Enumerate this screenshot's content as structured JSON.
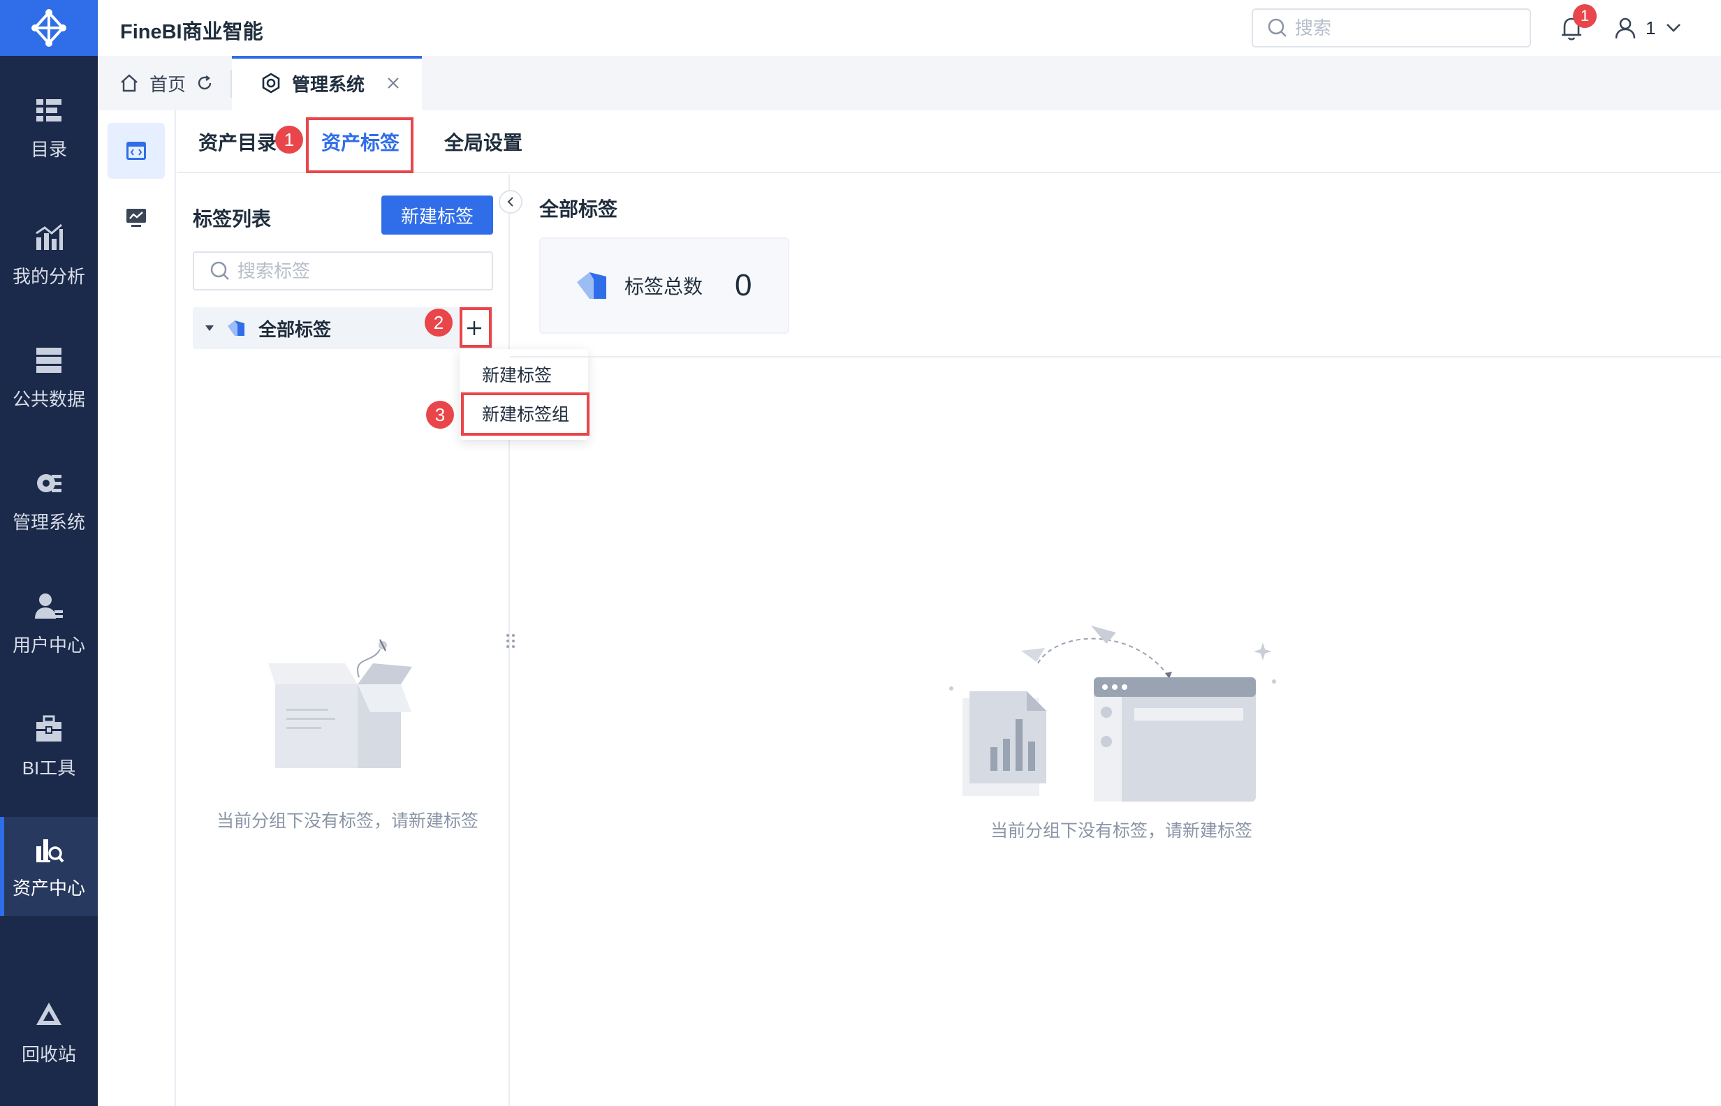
{
  "app": {
    "title": "FineBI商业智能"
  },
  "header": {
    "search_placeholder": "搜索",
    "notification_count": "1",
    "user_name": "1"
  },
  "nav": {
    "items": [
      {
        "label": "目录",
        "icon": "catalog-icon"
      },
      {
        "label": "我的分析",
        "icon": "analysis-icon"
      },
      {
        "label": "公共数据",
        "icon": "public-data-icon"
      },
      {
        "label": "管理系统",
        "icon": "gear-icon"
      },
      {
        "label": "用户中心",
        "icon": "user-center-icon"
      },
      {
        "label": "BI工具",
        "icon": "toolbox-icon"
      },
      {
        "label": "资产中心",
        "icon": "asset-center-icon",
        "active": true
      }
    ],
    "recycle_label": "回收站"
  },
  "tabs": {
    "home": "首页",
    "admin": "管理系统"
  },
  "content_tabs": [
    "资产目录",
    "资产标签",
    "全局设置"
  ],
  "steps": [
    "1",
    "2",
    "3"
  ],
  "left_panel": {
    "title": "标签列表",
    "new_button": "新建标签",
    "search_placeholder": "搜索标签",
    "tree_root": "全部标签",
    "empty_text": "当前分组下没有标签，请新建标签"
  },
  "menu": {
    "items": [
      "新建标签",
      "新建标签组"
    ]
  },
  "right_panel": {
    "title": "全部标签",
    "stat_label": "标签总数",
    "stat_value": "0",
    "empty_text": "当前分组下没有标签，请新建标签"
  },
  "colors": {
    "accent": "#2f6ee8",
    "nav_bg": "#1b2a4a",
    "highlight": "#e8464a"
  }
}
